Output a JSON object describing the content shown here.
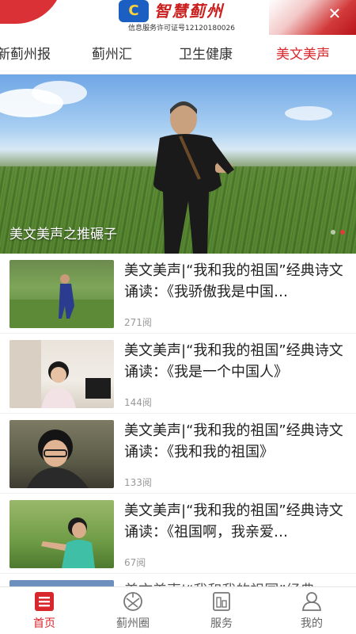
{
  "header": {
    "brand": "智慧蓟州",
    "license": "信息服务许可证号12120180026",
    "close": "✕"
  },
  "tabs": [
    {
      "label": "新蓟州报",
      "active": false
    },
    {
      "label": "蓟州汇",
      "active": false
    },
    {
      "label": "卫生健康",
      "active": false
    },
    {
      "label": "美文美声",
      "active": true
    }
  ],
  "hero": {
    "caption": "美文美声之推碾子",
    "total_slides": 2,
    "active_slide": 2
  },
  "articles": [
    {
      "title": "美文美声|“我和我的祖国”经典诗文诵读：《我骄傲我是中国…",
      "reads": "271阅"
    },
    {
      "title": "美文美声|“我和我的祖国”经典诗文诵读：《我是一个中国人》",
      "reads": "144阅"
    },
    {
      "title": "美文美声|“我和我的祖国”经典诗文诵读：《我和我的祖国》",
      "reads": "133阅"
    },
    {
      "title": "美文美声|“我和我的祖国”经典诗文诵读：《祖国啊，我亲爱…",
      "reads": "67阅"
    },
    {
      "title": "美文美声|“我和我的祖国”经典"
    }
  ],
  "bottom_nav": [
    {
      "label": "首页",
      "icon": "home-icon",
      "active": true
    },
    {
      "label": "蓟州圈",
      "icon": "circle-icon",
      "active": false
    },
    {
      "label": "服务",
      "icon": "service-icon",
      "active": false
    },
    {
      "label": "我的",
      "icon": "profile-icon",
      "active": false
    }
  ],
  "colors": {
    "accent": "#d8262b",
    "text": "#222222",
    "muted": "#999999"
  }
}
